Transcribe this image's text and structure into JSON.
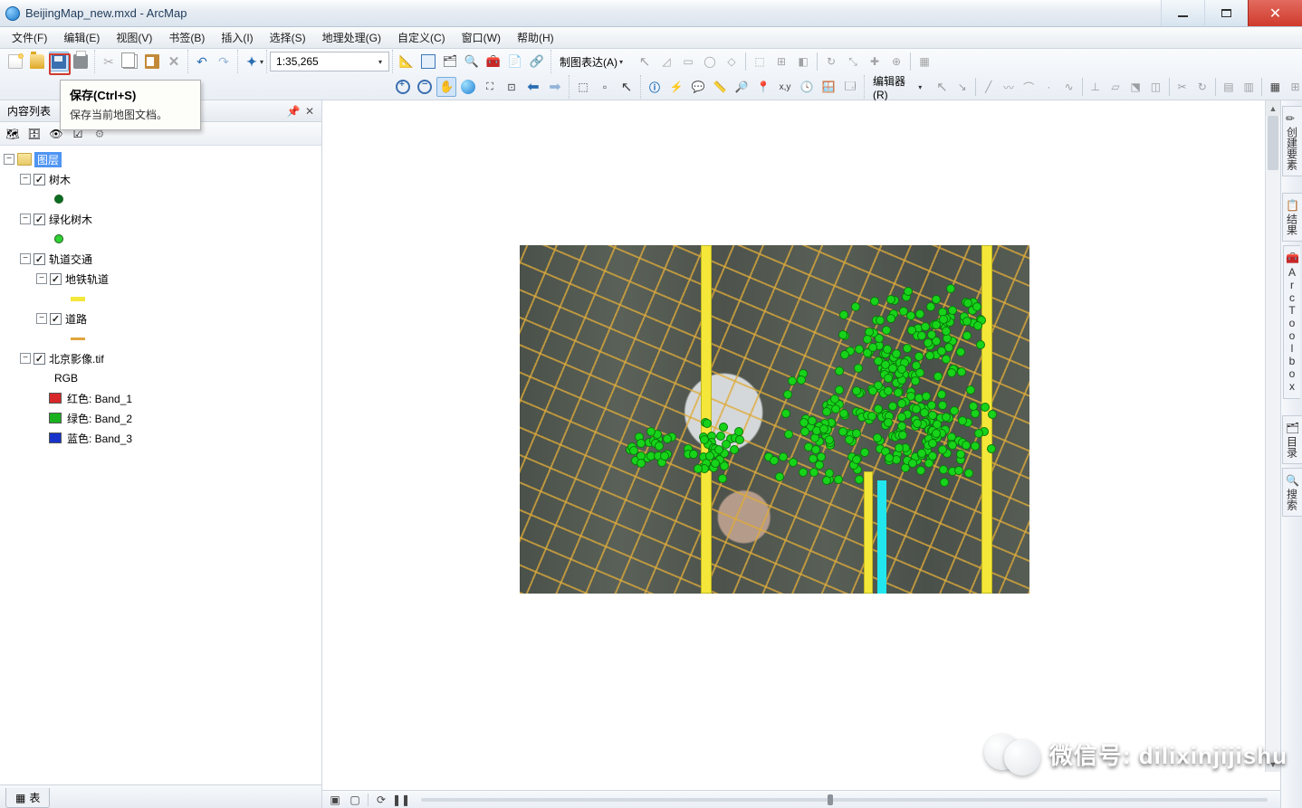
{
  "window": {
    "title": "BeijingMap_new.mxd - ArcMap"
  },
  "menu": [
    "文件(F)",
    "编辑(E)",
    "视图(V)",
    "书签(B)",
    "插入(I)",
    "选择(S)",
    "地理处理(G)",
    "自定义(C)",
    "窗口(W)",
    "帮助(H)"
  ],
  "scale": "1:35,265",
  "tooltip": {
    "title": "保存(Ctrl+S)",
    "body": "保存当前地图文档。"
  },
  "rep_label": "制图表达(A)",
  "editor_label": "编辑器(R)",
  "toc": {
    "title": "内容列表",
    "root": "图层",
    "layers": {
      "l1": "树木",
      "l2": "绿化树木",
      "l3": "轨道交通",
      "l3a": "地铁轨道",
      "l3b": "道路",
      "l4": "北京影像.tif",
      "rgb": "RGB",
      "b1": "红色:  Band_1",
      "b2": "绿色: Band_2",
      "b3": "蓝色:  Band_3"
    },
    "footer_tab": "表"
  },
  "right_tabs": [
    "创建要素",
    "结果",
    "ArcToolbox",
    "目录",
    "搜索"
  ],
  "watermark": "微信号: dilixinjijishu",
  "colors": {
    "tree_dot": "#0a6d23",
    "green_dot": "#2fd233",
    "yellow": "#f4e73a",
    "orange": "#e0a53d",
    "red": "#d8272a",
    "green": "#1ab11f",
    "blue": "#1733c9"
  }
}
